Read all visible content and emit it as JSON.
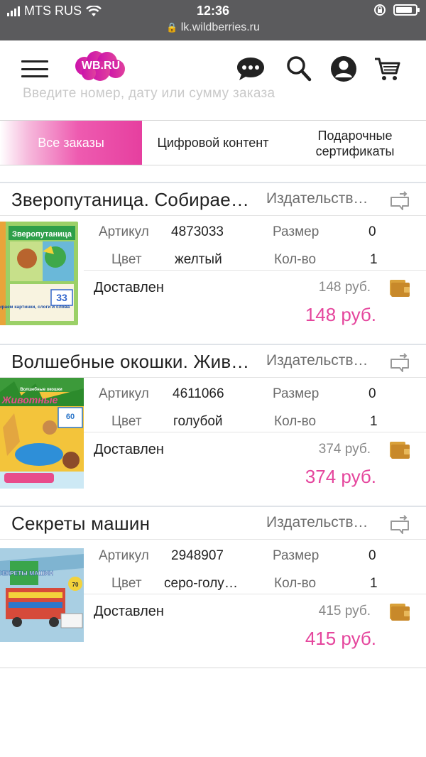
{
  "status_bar": {
    "carrier": "MTS RUS",
    "time": "12:36",
    "url": "lk.wildberries.ru",
    "battery_level": 0.85
  },
  "header": {
    "logo_text": "WB.RU",
    "brand_color": "#cb11ab",
    "icons": [
      "menu-icon",
      "chat-icon",
      "search-icon",
      "profile-icon",
      "cart-icon"
    ]
  },
  "search": {
    "placeholder": "Введите номер, дату или сумму заказа"
  },
  "tabs": [
    {
      "label": "Все заказы",
      "active": true
    },
    {
      "label": "Цифровой контент",
      "active": false
    },
    {
      "label_line1": "Подарочные",
      "label_line2": "сертификаты",
      "active": false
    }
  ],
  "labels": {
    "article": "Артикул",
    "size": "Размер",
    "color": "Цвет",
    "qty": "Кол-во"
  },
  "orders": [
    {
      "title": "Зверопутаница. Собираем картинки, слоги и слова",
      "brand": "Издательство Робинс",
      "article": "4873033",
      "size": "0",
      "color": "желтый",
      "qty": "1",
      "status": "Доставлен",
      "price": "148 руб.",
      "total": "148 руб.",
      "cover_title": "Зверопутаница",
      "cover_subtitle": "Собираем картинки, слоги и слова",
      "cover_badge": "33"
    },
    {
      "title": "Волшебные окошки. Животные",
      "brand": "Издательство Робинс",
      "article": "4611066",
      "size": "0",
      "color": "голубой",
      "qty": "1",
      "status": "Доставлен",
      "price": "374 руб.",
      "total": "374 руб.",
      "cover_title": "Животные",
      "cover_subtitle": "Волшебные окошки",
      "cover_badge": "60"
    },
    {
      "title": "Секреты машин",
      "brand": "Издательство Робинс",
      "article": "2948907",
      "size": "0",
      "color": "серо-голубой",
      "qty": "1",
      "status": "Доставлен",
      "price": "415 руб.",
      "total": "415 руб.",
      "cover_title": "СЕКРЕТЫ МАШИН",
      "cover_subtitle": "",
      "cover_badge": "70"
    }
  ]
}
